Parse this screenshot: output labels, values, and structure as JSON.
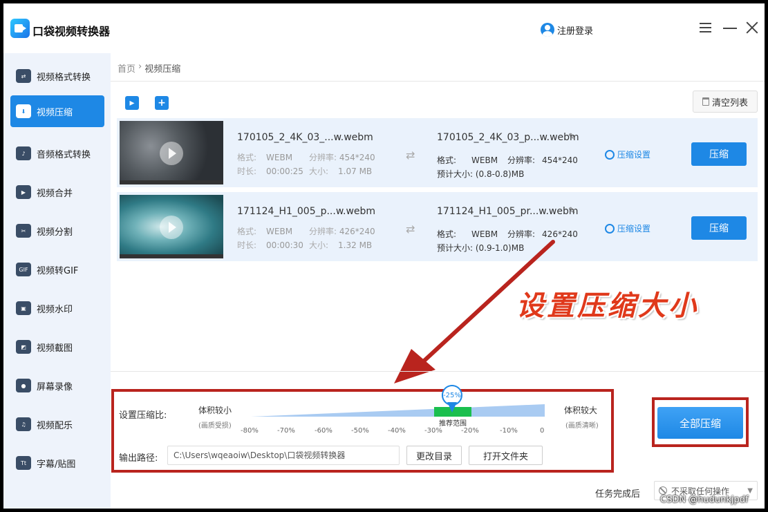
{
  "app": {
    "title": "口袋视频转换器",
    "login": "注册登录"
  },
  "sidebar": {
    "items": [
      {
        "label": "视频格式转换",
        "icon": "convert-icon",
        "glyph": "⇄"
      },
      {
        "label": "视频压缩",
        "icon": "compress-icon",
        "glyph": "⬇"
      },
      {
        "label": "音频格式转换",
        "icon": "audio-icon",
        "glyph": "♪"
      },
      {
        "label": "视频合并",
        "icon": "merge-icon",
        "glyph": "▶"
      },
      {
        "label": "视频分割",
        "icon": "split-icon",
        "glyph": "✂"
      },
      {
        "label": "视频转GIF",
        "icon": "gif-icon",
        "glyph": "GIF"
      },
      {
        "label": "视频水印",
        "icon": "watermark-icon",
        "glyph": "▣"
      },
      {
        "label": "视频截图",
        "icon": "screenshot-icon",
        "glyph": "◩"
      },
      {
        "label": "屏幕录像",
        "icon": "record-icon",
        "glyph": "●"
      },
      {
        "label": "视频配乐",
        "icon": "music-icon",
        "glyph": "♫"
      },
      {
        "label": "字幕/贴图",
        "icon": "subtitle-icon",
        "glyph": "Tt"
      }
    ]
  },
  "breadcrumb": {
    "home": "首页",
    "sep": "›",
    "current": "视频压缩"
  },
  "toolbar": {
    "clear_label": "清空列表"
  },
  "files": [
    {
      "src_name": "170105_2_4K_03_...w.webm",
      "src_format_label": "格式:",
      "src_format": "WEBM",
      "src_res_label": "分辨率:",
      "src_res": "454*240",
      "src_dur_label": "时长:",
      "src_dur": "00:00:25",
      "src_size_label": "大小:",
      "src_size": "1.07 MB",
      "out_name": "170105_2_4K_03_p...w.webm",
      "out_format_label": "格式:",
      "out_format": "WEBM",
      "out_res_label": "分辨率:",
      "out_res": "454*240",
      "out_est": "预计大小: (0.8-0.8)MB",
      "settings_label": "压缩设置",
      "compress_label": "压缩"
    },
    {
      "src_name": "171124_H1_005_p...w.webm",
      "src_format_label": "格式:",
      "src_format": "WEBM",
      "src_res_label": "分辨率:",
      "src_res": "426*240",
      "src_dur_label": "时长:",
      "src_dur": "00:00:30",
      "src_size_label": "大小:",
      "src_size": "1.32 MB",
      "out_name": "171124_H1_005_pr...w.webm",
      "out_format_label": "格式:",
      "out_format": "WEBM",
      "out_res_label": "分辨率:",
      "out_res": "426*240",
      "out_est": "预计大小: (0.9-1.0)MB",
      "settings_label": "压缩设置",
      "compress_label": "压缩"
    }
  ],
  "annotation": "设置压缩大小",
  "compression": {
    "ratio_label": "设置压缩比:",
    "left_label": "体积较小",
    "left_sub": "(画质受损)",
    "right_label": "体积较大",
    "right_sub": "(画质清晰)",
    "current": "-25%",
    "current_value": -25,
    "recommend": "推荐范围",
    "ticks": [
      "-80%",
      "-70%",
      "-60%",
      "-50%",
      "-40%",
      "-30%",
      "-20%",
      "-10%",
      "0"
    ],
    "output_label": "输出路径:",
    "output_path": "C:\\Users\\wqeaoiw\\Desktop\\口袋视频转换器",
    "change_dir": "更改目录",
    "open_folder": "打开文件夹",
    "compress_all": "全部压缩"
  },
  "task": {
    "label": "任务完成后",
    "value": "不采取任何操作"
  },
  "watermark": "CSDN @hudunkjpdf",
  "colors": {
    "accent": "#1e88e5",
    "highlight_box": "#b9241e",
    "annotation": "#e0391b",
    "recommend": "#1bbf4e"
  }
}
